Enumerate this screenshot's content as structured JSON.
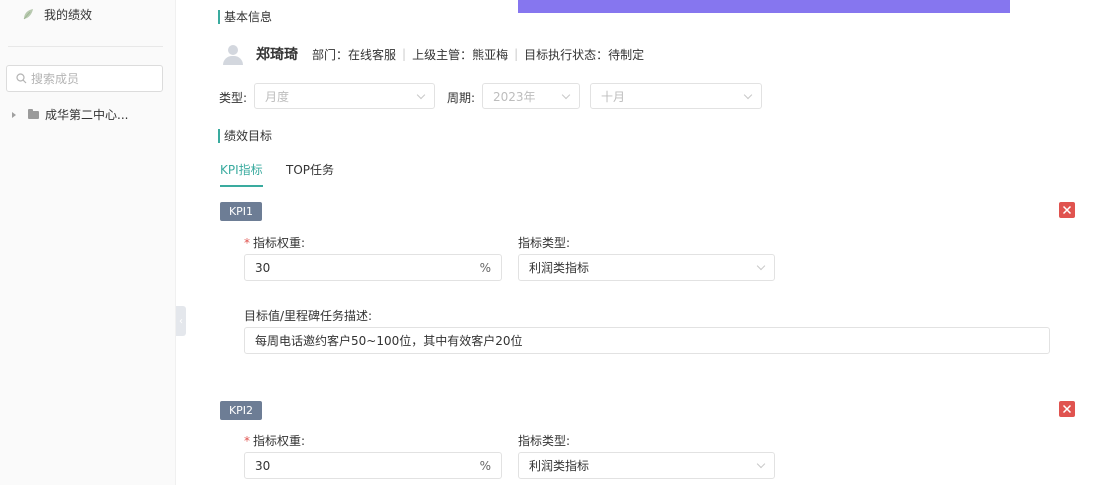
{
  "sidebar": {
    "title": "我的绩效",
    "search_placeholder": "搜索成员",
    "tree_node": "成华第二中心..."
  },
  "basic_info": {
    "section_title": "基本信息",
    "name": "郑琦琦",
    "dept_label": "部门：",
    "dept": "在线客服",
    "manager_label": "上级主管：",
    "manager": "熊亚梅",
    "status_label": "目标执行状态：",
    "status": "待制定"
  },
  "filters": {
    "type_label": "类型:",
    "type_value": "月度",
    "period_label": "周期:",
    "year_value": "2023年",
    "month_value": "十月"
  },
  "goals": {
    "section_title": "绩效目标",
    "tabs": [
      {
        "label": "KPI指标",
        "active": true
      },
      {
        "label": "TOP任务",
        "active": false
      }
    ]
  },
  "kpis": [
    {
      "tag": "KPI1",
      "weight_label": "指标权重:",
      "weight_value": "30",
      "weight_unit": "%",
      "type_label": "指标类型:",
      "type_value": "利润类指标",
      "desc_label": "目标值/里程碑任务描述:",
      "desc_value": "每周电话邀约客户50~100位，其中有效客户20位"
    },
    {
      "tag": "KPI2",
      "weight_label": "指标权重:",
      "weight_value": "30",
      "weight_unit": "%",
      "type_label": "指标类型:",
      "type_value": "利润类指标"
    }
  ],
  "colors": {
    "accent": "#3aab9f",
    "top_bar": "#8676ef",
    "kpi_tag": "#6d7d95",
    "delete": "#e0534f"
  },
  "icons": [
    "leaf-icon",
    "search-icon",
    "caret-right-icon",
    "folder-icon",
    "chevron-left-icon",
    "chevron-down-icon",
    "close-icon"
  ]
}
